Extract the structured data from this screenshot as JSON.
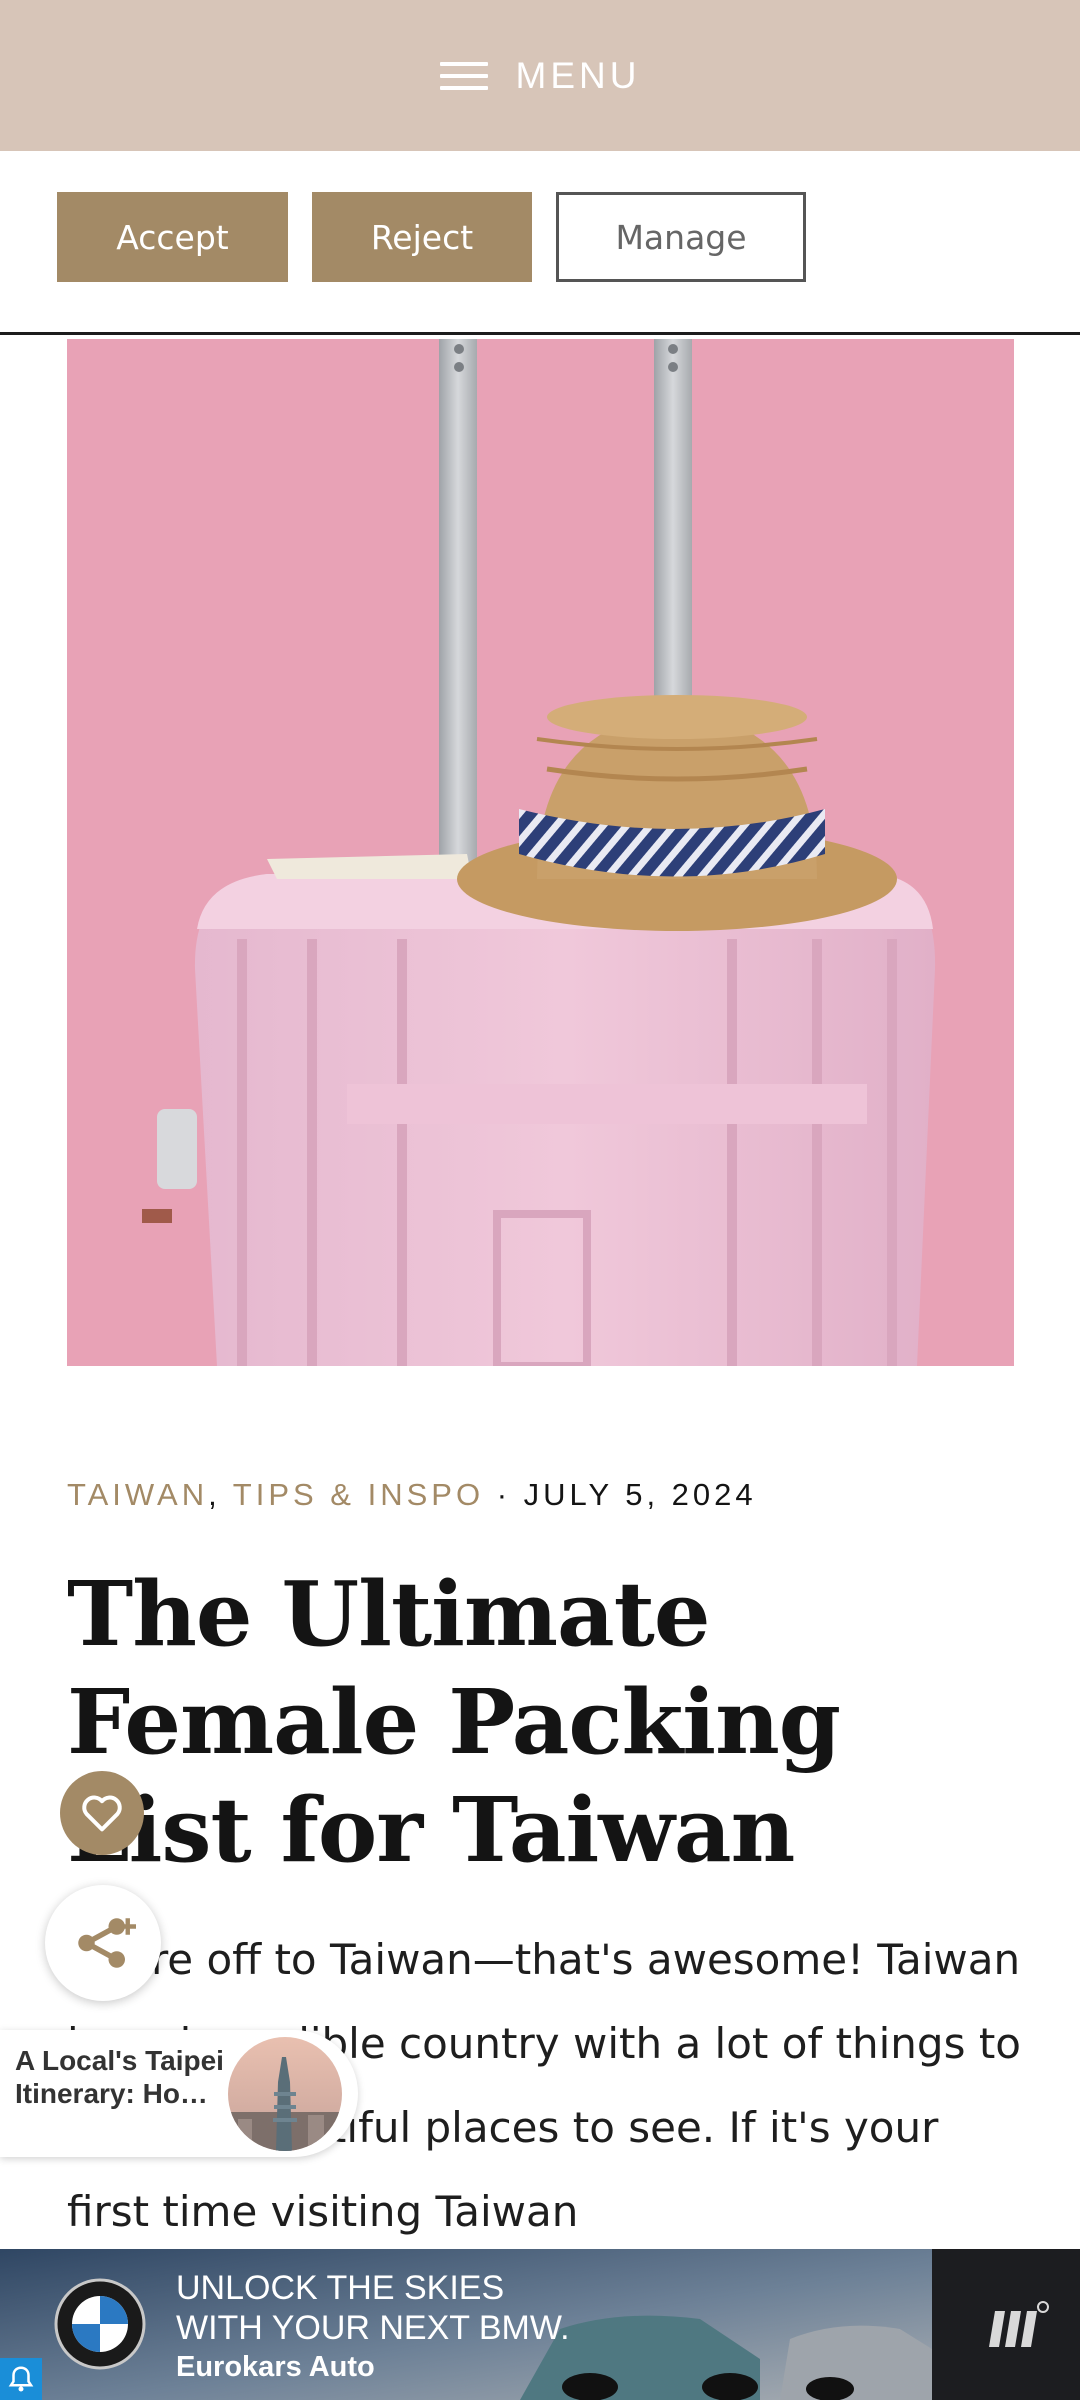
{
  "header": {
    "menu_label": "MENU"
  },
  "cookie_bar": {
    "accept_label": "Accept",
    "reject_label": "Reject",
    "manage_label": "Manage"
  },
  "article": {
    "categories": [
      "TAIWAN",
      "TIPS & INSPO"
    ],
    "category_separator": ",",
    "meta_separator": "·",
    "date": "JULY 5, 2024",
    "title": "The Ultimate Female Packing List for Taiwan",
    "body_intro": "You're off to Taiwan—that's awesome! Taiwan is an incredible country with a lot of things to do and beautiful places to see. If it's your first time visiting Taiwan"
  },
  "related_card": {
    "title": "A Local's Taipei Itinerary: Ho…"
  },
  "ad": {
    "line1": "UNLOCK THE SKIES",
    "line2": "WITH YOUR NEXT BMW.",
    "line3": "Eurokars Auto"
  },
  "colors": {
    "header_bg": "#d7c5b8",
    "accent": "#a38a66",
    "hero_bg": "#e8a2b6"
  },
  "icons": [
    "hamburger-icon",
    "heart-icon",
    "share-icon",
    "bmw-logo",
    "ad-brand-icon",
    "ad-info-icon"
  ]
}
